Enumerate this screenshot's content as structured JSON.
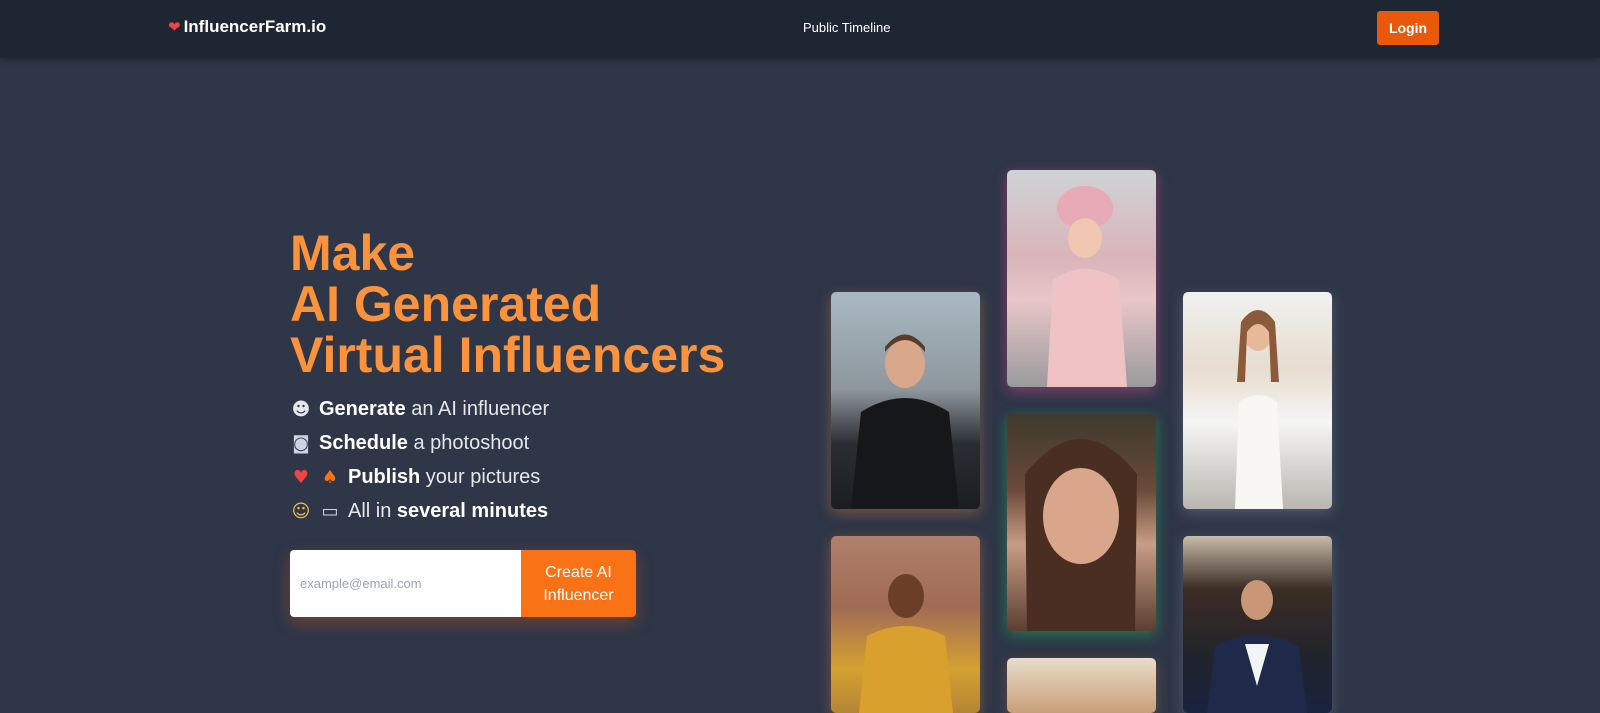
{
  "nav": {
    "logo_icon": "heart-icon",
    "brand": "InfluencerFarm.io",
    "public_timeline": "Public Timeline",
    "login": "Login"
  },
  "hero": {
    "headline": [
      "Make",
      "AI Generated",
      "Virtual Influencers"
    ],
    "features": [
      {
        "icons": [
          "robot-face-icon"
        ],
        "bold": "Generate",
        "rest": " an AI influencer"
      },
      {
        "icons": [
          "camera-icon"
        ],
        "bold": "Schedule",
        "rest": " a photoshoot"
      },
      {
        "icons": [
          "red-heart-icon",
          "fire-icon"
        ],
        "bold": "Publish",
        "rest": " your pictures"
      },
      {
        "icons": [
          "boy-face-icon",
          "laptop-icon"
        ],
        "prefix": "All in ",
        "bold": "several minutes"
      }
    ],
    "email_placeholder": "example@email.com",
    "cta": "Create AI Influencer"
  },
  "gallery": [
    {
      "name": "young-man-dark-coat-photo"
    },
    {
      "name": "woman-pink-coat-photo"
    },
    {
      "name": "woman-white-dress-photo"
    },
    {
      "name": "woman-portrait-photo"
    },
    {
      "name": "woman-yellow-dress-photo"
    },
    {
      "name": "man-navy-blazer-photo"
    },
    {
      "name": "street-scene-photo"
    }
  ],
  "colors": {
    "background": "#2e3648",
    "navbar": "#1e2634",
    "accent": "#ea580c",
    "headline": "#fb923c",
    "cta": "#f97316"
  }
}
